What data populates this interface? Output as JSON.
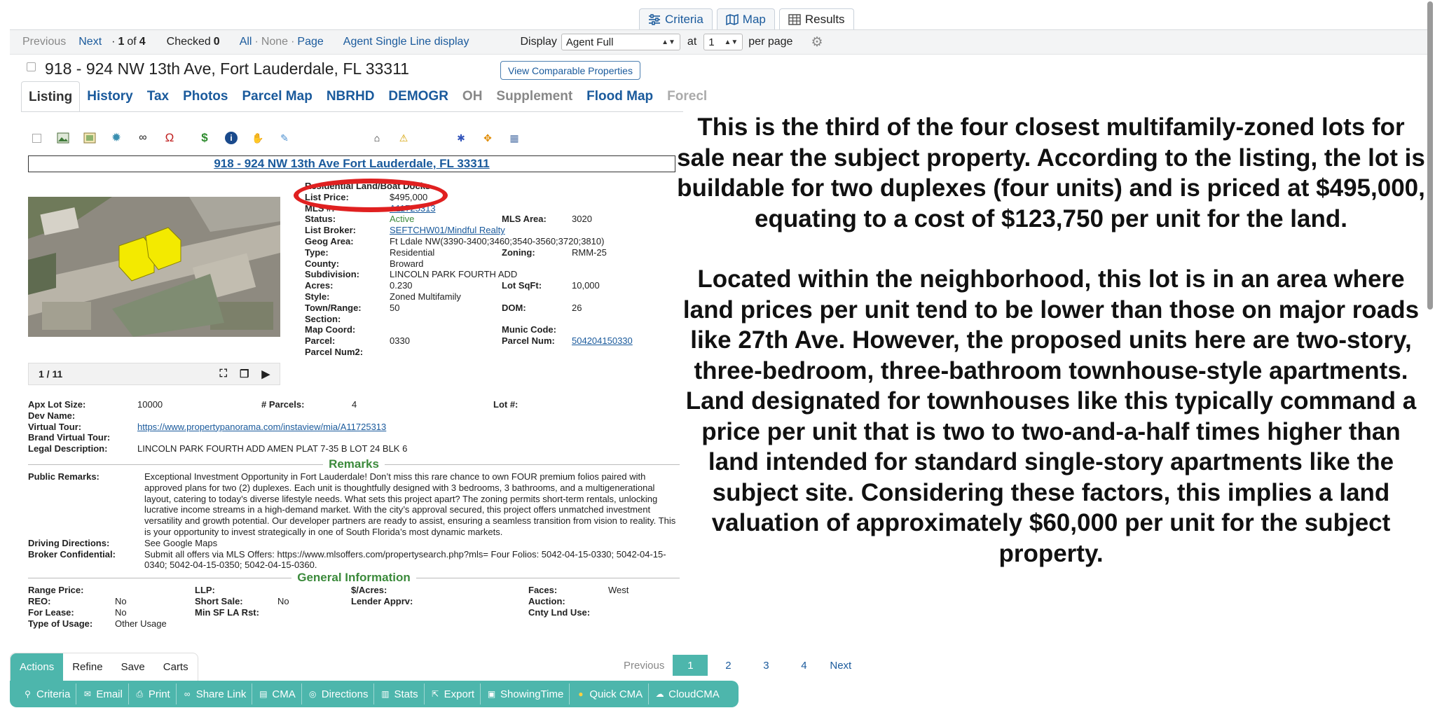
{
  "view_tabs": [
    {
      "label": "Criteria",
      "icon": "sliders-icon"
    },
    {
      "label": "Map",
      "icon": "map-icon"
    },
    {
      "label": "Results",
      "icon": "table-icon"
    }
  ],
  "nav": {
    "previous": "Previous",
    "next": "Next",
    "position_prefix": "·",
    "position_current": "1",
    "position_of": "of",
    "position_total": "4",
    "checked_label": "Checked",
    "checked_count": "0",
    "select_all": "All",
    "select_none": "None",
    "select_page": "Page",
    "dot": "·",
    "agent_single_line": "Agent Single Line display",
    "display_label": "Display",
    "display_value": "Agent Full",
    "at_label": "at",
    "per_page_value": "1",
    "per_page_label": "per page"
  },
  "listing": {
    "title": "918 - 924 NW 13th Ave, Fort Lauderdale, FL 33311",
    "comparable_button": "View Comparable Properties",
    "address_link": "918 - 924 NW 13th Ave Fort Lauderdale, FL 33311"
  },
  "section_tabs": [
    "Listing",
    "History",
    "Tax",
    "Photos",
    "Parcel Map",
    "NBRHD",
    "DEMOGR",
    "OH",
    "Supplement",
    "Flood Map",
    "Forecl"
  ],
  "photo": {
    "counter": "1 / 11"
  },
  "details": {
    "category": "Residential Land/Boat Docks",
    "list_price_label": "List Price:",
    "list_price": "$495,000",
    "mls_label": "MLS #:",
    "mls": "A11725313",
    "status_label": "Status:",
    "status": "Active",
    "mls_area_label": "MLS Area:",
    "mls_area": "3020",
    "broker_label": "List Broker:",
    "broker": "SEFTCHW01/Mindful Realty",
    "geog_label": "Geog Area:",
    "geog": "Ft Ldale NW(3390-3400;3460;3540-3560;3720;3810)",
    "type_label": "Type:",
    "type": "Residential",
    "zoning_label": "Zoning:",
    "zoning": "RMM-25",
    "county_label": "County:",
    "county": "Broward",
    "subdivision_label": "Subdivision:",
    "subdivision": "LINCOLN PARK FOURTH ADD",
    "acres_label": "Acres:",
    "acres": "0.230",
    "lot_sqft_label": "Lot SqFt:",
    "lot_sqft": "10,000",
    "style_label": "Style:",
    "style": "Zoned Multifamily",
    "town_label": "Town/Range:",
    "town": "50",
    "dom_label": "DOM:",
    "dom": "26",
    "section_label": "Section:",
    "map_coord_label": "Map Coord:",
    "munic_label": "Munic Code:",
    "parcel_label": "Parcel:",
    "parcel": "0330",
    "parcel_num_label": "Parcel Num:",
    "parcel_num": "504204150330",
    "parcel_num2_label": "Parcel Num2:"
  },
  "lower": {
    "apx_lot_label": "Apx Lot Size:",
    "apx_lot": "10000",
    "parcels_label": "# Parcels:",
    "parcels": "4",
    "lot_num_label": "Lot #:",
    "dev_name_label": "Dev Name:",
    "virtual_tour_label": "Virtual Tour:",
    "virtual_tour": "https://www.propertypanorama.com/instaview/mia/A11725313",
    "brand_tour_label": "Brand Virtual Tour:",
    "legal_label": "Legal Description:",
    "legal": "LINCOLN PARK FOURTH ADD AMEN PLAT 7-35 B LOT 24 BLK 6",
    "remarks_heading": "Remarks",
    "public_remarks_label": "Public Remarks:",
    "public_remarks": "Exceptional Investment Opportunity in Fort Lauderdale! Don’t miss this rare chance to own FOUR premium folios paired with approved plans for two (2) duplexes. Each unit is thoughtfully designed with 3 bedrooms, 3 bathrooms, and a multigenerational layout, catering to today’s diverse lifestyle needs. What sets this project apart? The zoning permits short-term rentals, unlocking lucrative income streams in a high-demand market. With the city’s approval secured, this project offers unmatched investment versatility and growth potential. Our developer partners are ready to assist, ensuring a seamless transition from vision to reality. This is your opportunity to invest strategically in one of South Florida’s most dynamic markets.",
    "driving_label": "Driving Directions:",
    "driving": "See Google Maps",
    "broker_conf_label": "Broker Confidential:",
    "broker_conf": "Submit all offers via MLS Offers: https://www.mlsoffers.com/propertysearch.php?mls= Four Folios: 5042-04-15-0330; 5042-04-15-0340; 5042-04-15-0350; 5042-04-15-0360.",
    "general_heading": "General Information",
    "range_price_label": "Range Price:",
    "llp_label": "LLP:",
    "per_acre_label": "$/Acres:",
    "faces_label": "Faces:",
    "faces": "West",
    "reo_label": "REO:",
    "reo": "No",
    "short_sale_label": "Short Sale:",
    "short_sale": "No",
    "lender_label": "Lender Apprv:",
    "auction_label": "Auction:",
    "for_lease_label": "For Lease:",
    "for_lease": "No",
    "min_sf_label": "Min SF LA Rst:",
    "cnty_lnd_label": "Cnty Lnd Use:",
    "type_usage_label": "Type of Usage:",
    "type_usage": "Other Usage"
  },
  "annotation": {
    "para1": "This is the third of the four closest multifamily-zoned lots for sale near the subject property. According to the listing, the lot is buildable for two duplexes (four units) and is priced at $495,000, equating to a cost of $123,750 per unit for the land.",
    "para2": "Located within the neighborhood, this lot is in an area where land prices per unit tend to be lower than those on major roads like 27th Ave. However, the proposed units here are two-story, three-bedroom, three-bathroom townhouse-style apartments. Land designated for townhouses like this typically command a price per unit that is two to two-and-a-half times higher than land intended for standard single-story apartments like the subject site. Considering these factors, this implies a land valuation of approximately $60,000 per unit for the subject property."
  },
  "pager": {
    "previous": "Previous",
    "pages": [
      "1",
      "2",
      "3",
      "4"
    ],
    "current": "1",
    "next": "Next"
  },
  "actions": {
    "tabs": [
      "Actions",
      "Refine",
      "Save",
      "Carts"
    ],
    "buttons": [
      "Criteria",
      "Email",
      "Print",
      "Share Link",
      "CMA",
      "Directions",
      "Stats",
      "Export",
      "ShowingTime",
      "Quick CMA",
      "CloudCMA"
    ]
  },
  "colors": {
    "accent": "#4db6ac",
    "link": "#1a5a9c",
    "section_heading": "#3b8a3b",
    "highlight_circle": "#e02020"
  }
}
